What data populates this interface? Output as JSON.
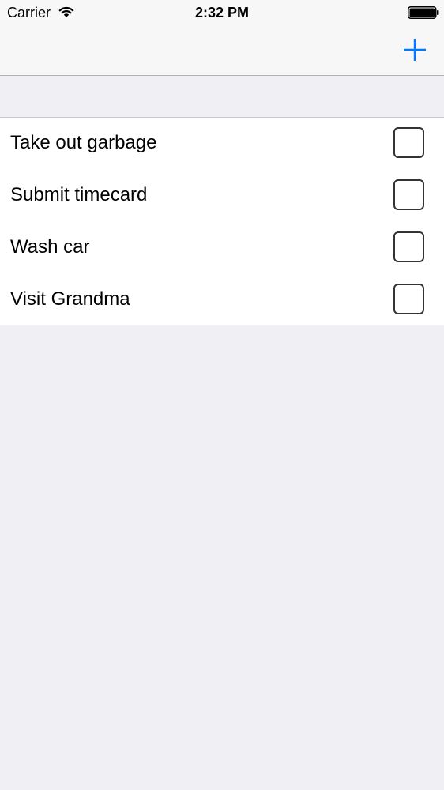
{
  "status_bar": {
    "carrier": "Carrier",
    "time": "2:32 PM",
    "icons": [
      "wifi-icon",
      "battery-icon"
    ]
  },
  "nav_bar": {
    "add_button_icon": "plus-icon",
    "accent_color": "#007aff"
  },
  "tasks": [
    {
      "title": "Take out garbage",
      "checked": false
    },
    {
      "title": "Submit timecard",
      "checked": false
    },
    {
      "title": "Wash car",
      "checked": false
    },
    {
      "title": "Visit Grandma",
      "checked": false
    }
  ]
}
